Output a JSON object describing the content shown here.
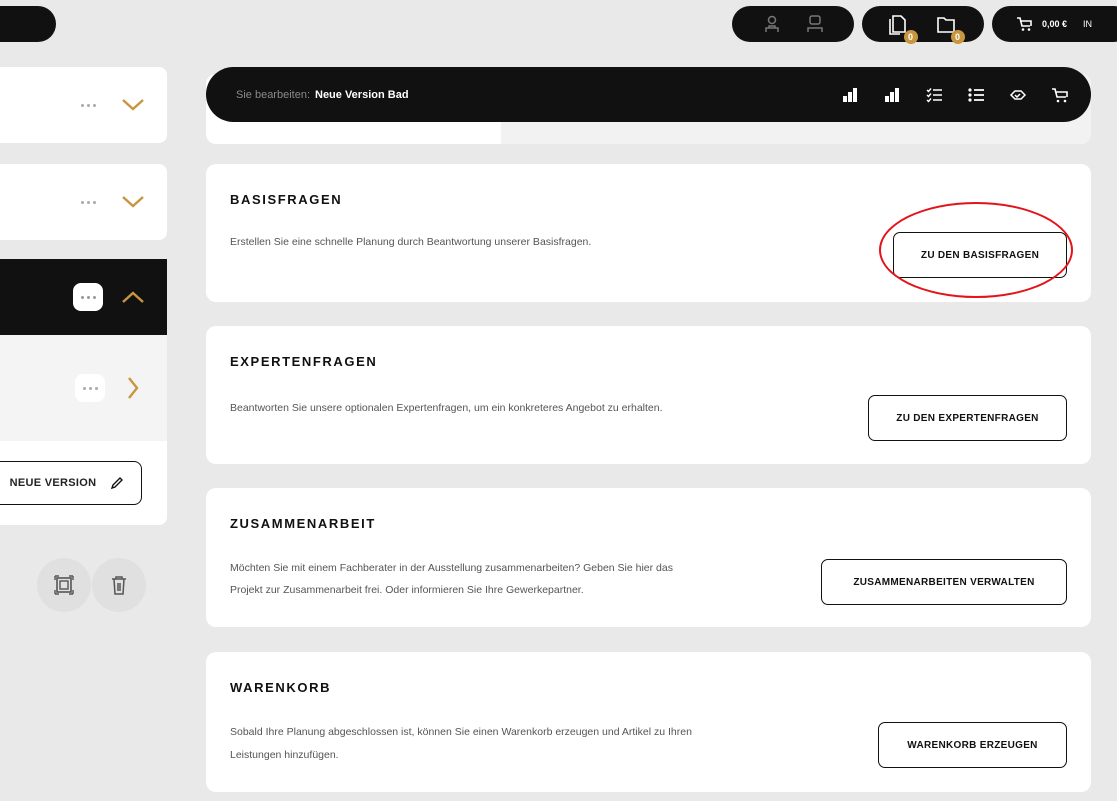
{
  "header": {
    "cart_total": "0,00 €",
    "cart_overflow": "IN",
    "compare_badge_1": "0",
    "compare_badge_2": "0"
  },
  "edit_bar": {
    "label": "Sie bearbeiten:",
    "value": "Neue Version Bad"
  },
  "sidebar": {
    "new_version_label": "NEUE VERSION"
  },
  "cards": [
    {
      "title": "BASISFRAGEN",
      "text": "Erstellen Sie eine schnelle Planung durch Beantwortung unserer Basisfragen.",
      "button": "ZU DEN BASISFRAGEN"
    },
    {
      "title": "EXPERTENFRAGEN",
      "text": "Beantworten Sie unsere optionalen Expertenfragen, um ein konkreteres Angebot zu erhalten.",
      "button": "ZU DEN EXPERTENFRAGEN"
    },
    {
      "title": "ZUSAMMENARBEIT",
      "text_line1": "Möchten Sie mit einem Fachberater in der Ausstellung zusammenarbeiten? Geben Sie hier das",
      "text_line2": "Projekt zur Zusammenarbeit frei. Oder informieren Sie Ihre Gewerkepartner.",
      "button": "ZUSAMMENARBEITEN VERWALTEN"
    },
    {
      "title": "WARENKORB",
      "text_line1": "Sobald Ihre Planung abgeschlossen ist, können Sie einen Warenkorb erzeugen und Artikel zu Ihren",
      "text_line2": "Leistungen hinzufügen.",
      "button": "WARENKORB ERZEUGEN"
    }
  ],
  "colors": {
    "accent_gold": "#c8963e",
    "highlight_red": "#e3141b",
    "dark": "#111111"
  }
}
